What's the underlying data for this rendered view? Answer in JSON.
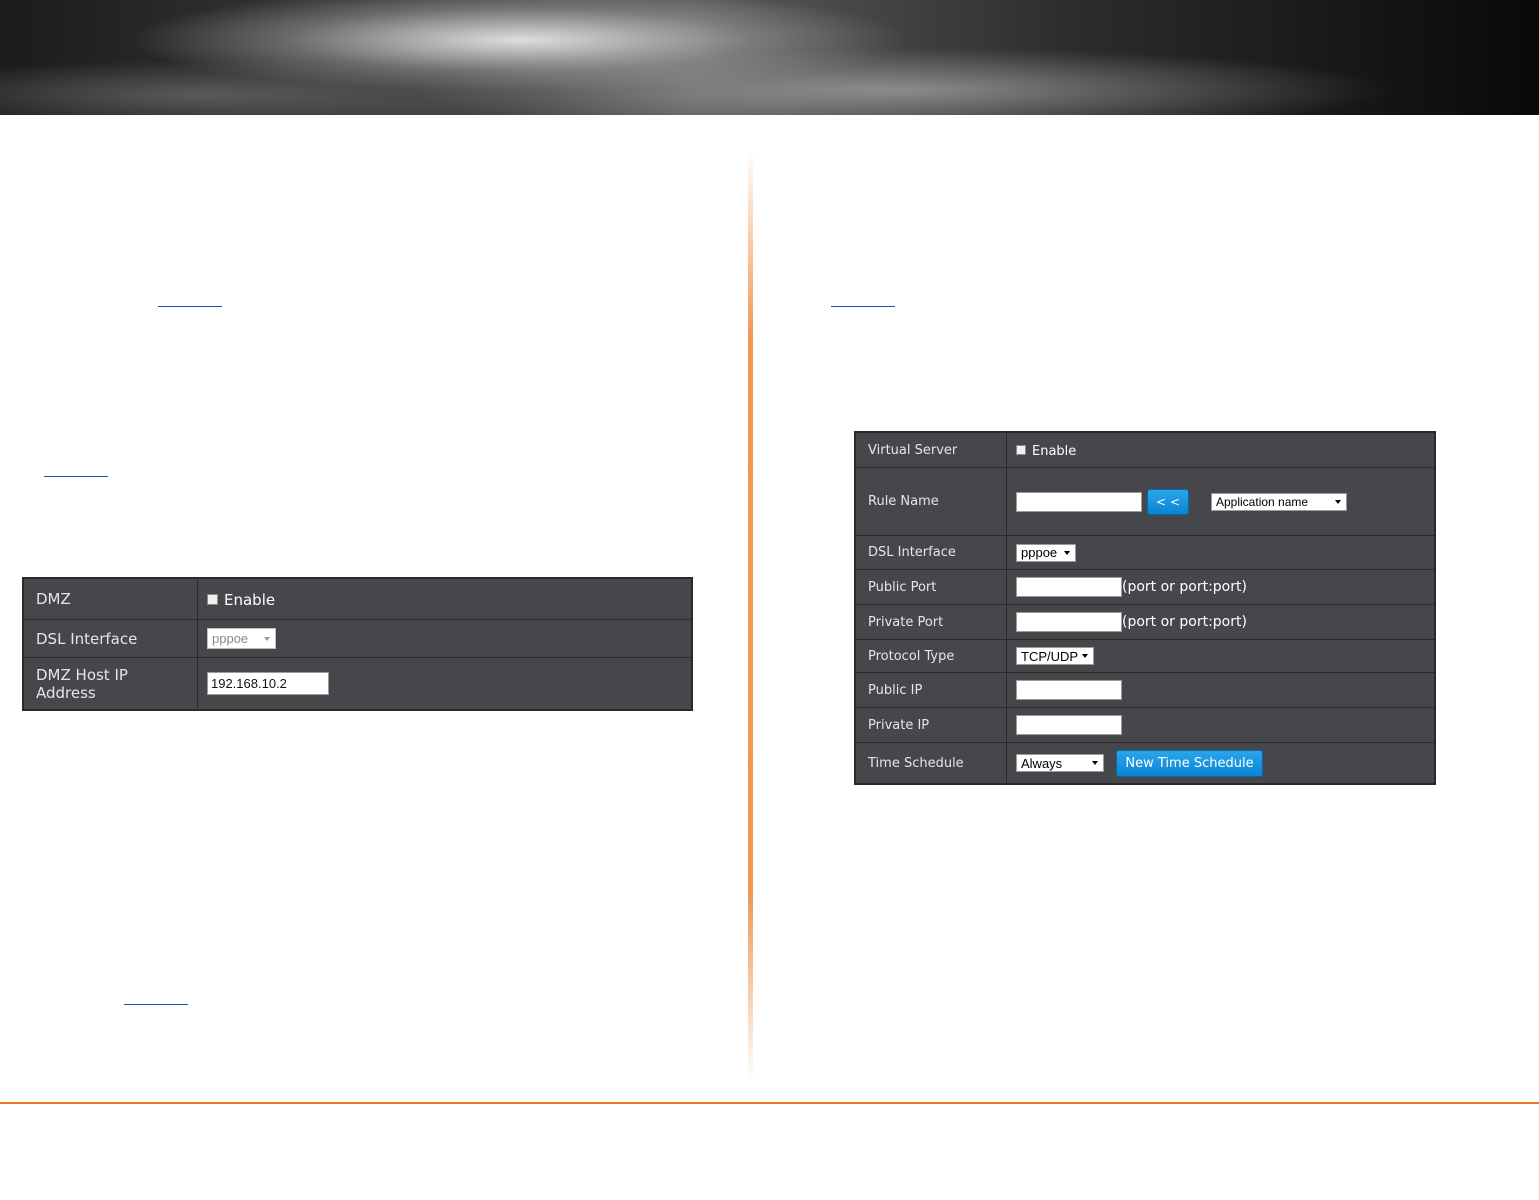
{
  "dmz_form": {
    "rows": [
      {
        "label": "DMZ",
        "checkbox_label": "Enable"
      },
      {
        "label": "DSL Interface",
        "select_value": "pppoe"
      },
      {
        "label_line1": "DMZ Host IP",
        "label_line2": "Address",
        "input_value": "192.168.10.2"
      }
    ]
  },
  "virtual_server_form": {
    "rows": [
      {
        "label": "Virtual Server",
        "checkbox_label": "Enable"
      },
      {
        "label": "Rule Name",
        "input_value": "",
        "copy_button": "< <",
        "app_select": "Application name"
      },
      {
        "label": "DSL Interface",
        "select_value": "pppoe"
      },
      {
        "label": "Public Port",
        "input_value": "",
        "hint": "(port or port:port)"
      },
      {
        "label": "Private Port",
        "input_value": "",
        "hint": "(port or port:port)"
      },
      {
        "label": "Protocol Type",
        "select_value": "TCP/UDP"
      },
      {
        "label": "Public IP",
        "input_value": ""
      },
      {
        "label": "Private IP",
        "input_value": ""
      },
      {
        "label": "Time Schedule",
        "select_value": "Always",
        "button": "New Time Schedule"
      }
    ]
  },
  "colors": {
    "panel_bg": "#46474a",
    "accent_orange": "#e8742c",
    "button_blue": "#0a84d6",
    "link_blue": "#1a4fc2"
  }
}
